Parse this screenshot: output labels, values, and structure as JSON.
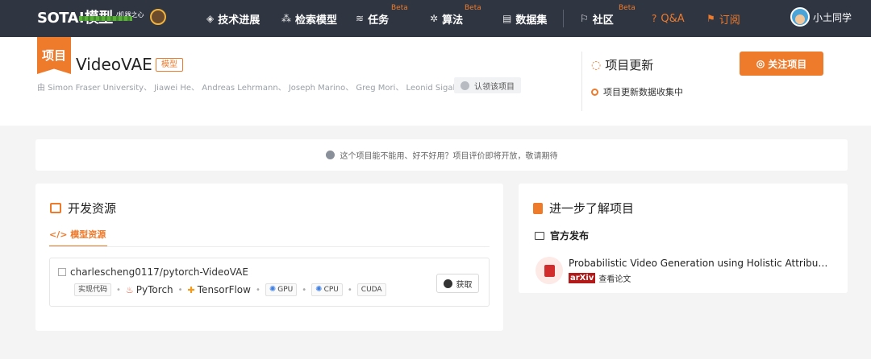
{
  "nav": {
    "logo_text": "SOTA!模型",
    "logo_sub": "/机器之心",
    "items": [
      {
        "label": "技术进展",
        "icon": "layers-icon"
      },
      {
        "label": "检索模型",
        "icon": "nodes-icon"
      },
      {
        "label": "任务",
        "icon": "stack-icon",
        "beta": "Beta"
      },
      {
        "label": "算法",
        "icon": "algorithm-icon",
        "beta": "Beta"
      },
      {
        "label": "数据集",
        "icon": "database-icon"
      },
      {
        "label": "社区",
        "icon": "flag-icon",
        "beta": "Beta"
      },
      {
        "label": "Q&A",
        "icon": "question-icon"
      },
      {
        "label": "订阅",
        "icon": "bookmark-icon"
      }
    ],
    "user_name": "小土同学"
  },
  "project": {
    "ribbon": "项目",
    "title": "VideoVAE",
    "tag": "模型",
    "authors": "由 Simon Fraser University、 Jiawei He、 Andreas Lehrmann、 Joseph Marino、 Greg Mori、 Leonid Sigal 研发",
    "claim_label": "认领该项目"
  },
  "updates": {
    "title": "项目更新",
    "status": "项目更新数据收集中",
    "follow_label": "关注项目"
  },
  "notice": "这个项目能不能用、好不好用？项目评价即将开放，敬请期待",
  "dev": {
    "title": "开发资源",
    "tab": "模型资源",
    "repo": "charlescheng0117/pytorch-VideoVAE",
    "chip_code": "实现代码",
    "framework1": "PyTorch",
    "framework2": "TensorFlow",
    "chip_gpu": "GPU",
    "chip_cpu": "CPU",
    "chip_cuda": "CUDA",
    "get_label": "获取"
  },
  "learn": {
    "title": "进一步了解项目",
    "sub": "官方发布",
    "paper_title": "Probabilistic Video Generation using Holistic Attribute Control",
    "arxiv": "arXiv",
    "link": "查看论文"
  },
  "colors": {
    "accent": "#ee7a2c",
    "nav_bg": "#2f3642",
    "arxiv": "#b31b1b"
  }
}
